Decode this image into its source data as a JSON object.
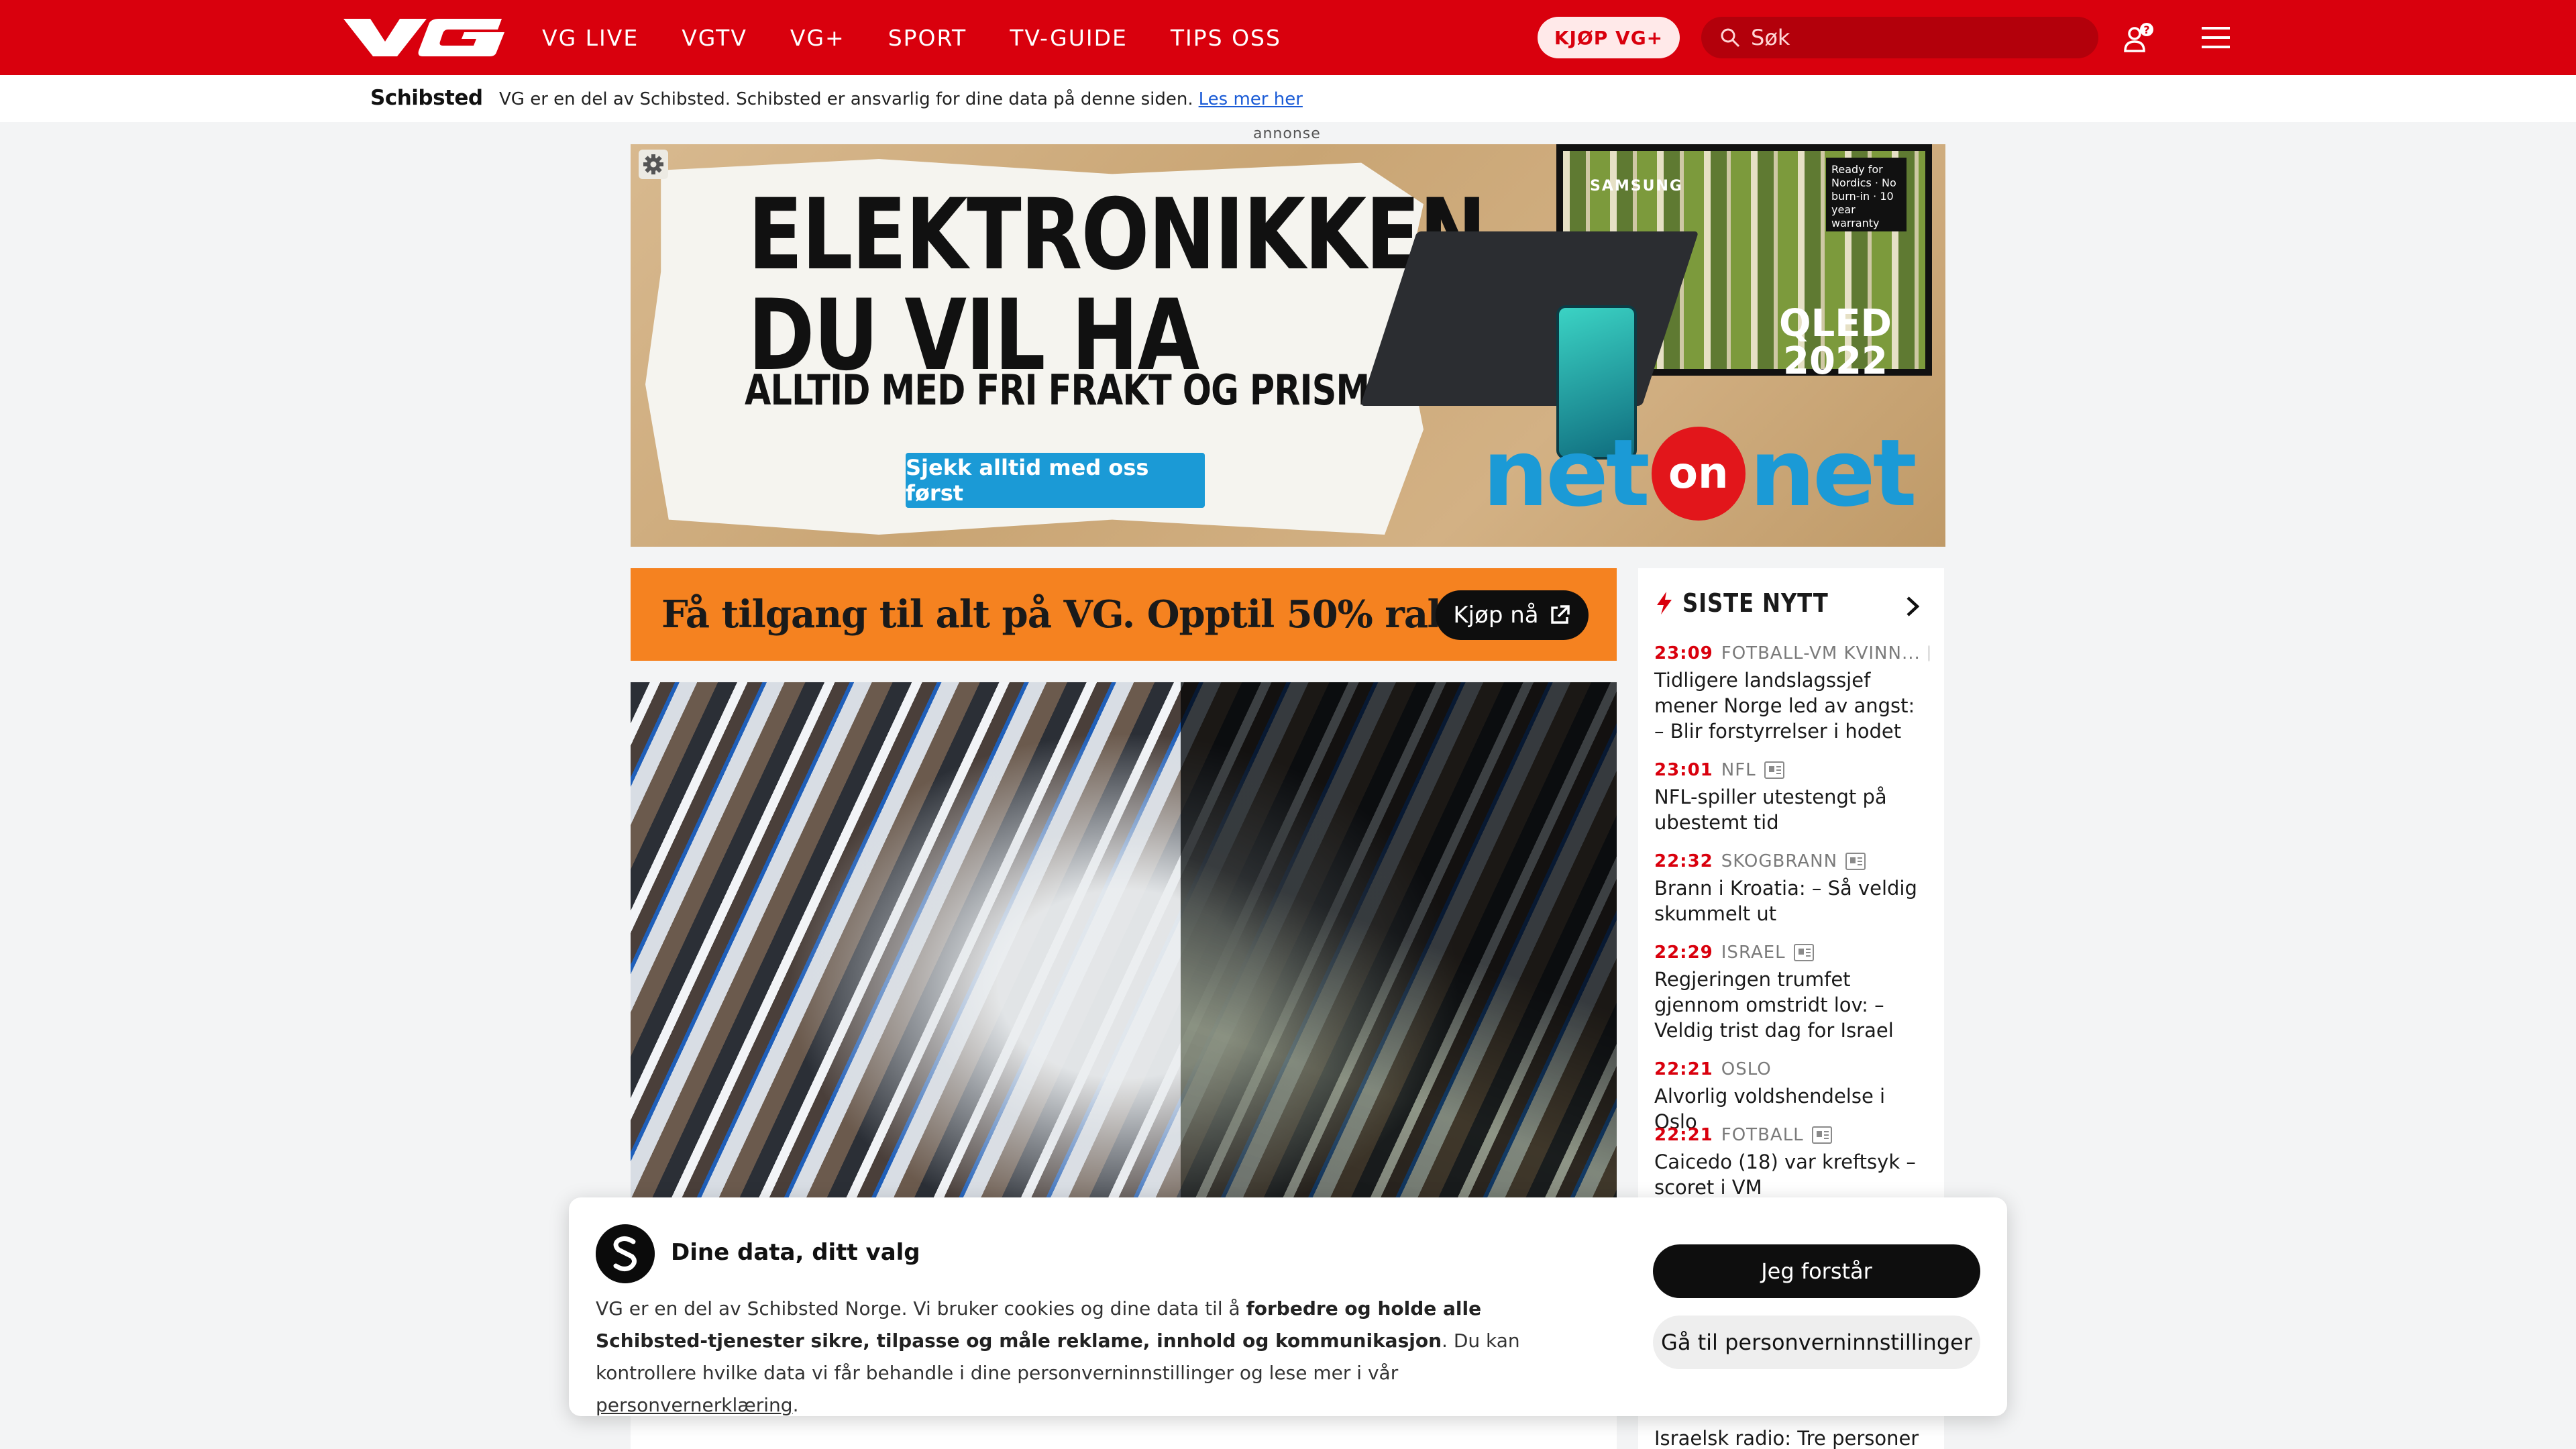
{
  "brand": {
    "accent": "#d9000d",
    "promo_orange": "#f58220",
    "link_blue": "#1a5bd6"
  },
  "header": {
    "logo_alt": "VG",
    "nav": [
      "VG LIVE",
      "VGTV",
      "VG+",
      "SPORT",
      "TV-GUIDE",
      "TIPS OSS"
    ],
    "buy_label": "KJØP VG+",
    "search_placeholder": "Søk",
    "user_badge": "?"
  },
  "schibsted_bar": {
    "logo": "Schibsted",
    "text": "VG er en del av Schibsted. Schibsted er ansvarlig for dine data på denne siden.",
    "link": "Les mer her"
  },
  "ad": {
    "label": "annonse",
    "headline_line1": "ELEKTRONIKKEN",
    "headline_line2": "DU VIL HA",
    "subline": "ALLTID MED FRI FRAKT OG PRISMATCH",
    "cta": "Sjekk alltid med oss først",
    "tv_brand": "SAMSUNG",
    "tv_badge": "Ready for Nordics · No burn-in · 10 year warranty",
    "tv_model_line1": "QLED",
    "tv_model_line2": "2022",
    "advertiser_left": "net",
    "advertiser_mid": "on",
    "advertiser_right": "net"
  },
  "promo": {
    "text": "Få tilgang til alt på VG. Opptil 50% rabatt",
    "button": "Kjøp nå"
  },
  "sidebar": {
    "title": "SISTE NYTT",
    "items": [
      {
        "time": "23:09",
        "category": "FOTBALL-VM KVINN...",
        "title": "Tidligere landslagssjef mener Norge led av angst: – Blir forstyrrelser i hodet",
        "article_icon": true
      },
      {
        "time": "23:01",
        "category": "NFL",
        "title": "NFL-spiller utestengt på ubestemt tid",
        "article_icon": true
      },
      {
        "time": "22:32",
        "category": "SKOGBRANN",
        "title": "Brann i Kroatia: – Så veldig skummelt ut",
        "article_icon": true
      },
      {
        "time": "22:29",
        "category": "ISRAEL",
        "title": "Regjeringen trumfet gjennom omstridt lov: – Veldig trist dag for Israel",
        "article_icon": true
      },
      {
        "time": "22:21",
        "category": "OSLO",
        "title": "Alvorlig voldshendelse i Oslo",
        "article_icon": false
      },
      {
        "time": "22:21",
        "category": "FOTBALL",
        "title": "Caicedo (18) var kreftsyk – scoret i VM",
        "article_icon": true
      },
      {
        "time": "",
        "category": "",
        "title": "Israelsk radio: Tre personer",
        "article_icon": false
      }
    ]
  },
  "consent": {
    "title": "Dine data, ditt valg",
    "body_1": "VG er en del av Schibsted Norge. Vi bruker cookies og dine data til å ",
    "body_bold": "forbedre og holde alle Schibsted-tjenester sikre, tilpasse og måle reklame, innhold og kommunikasjon",
    "body_2": ". Du kan kontrollere hvilke data vi får behandle i dine personverninnstillinger og lese mer i vår ",
    "body_link": "personvernerklæring",
    "body_end": ".",
    "accept": "Jeg forstår",
    "settings": "Gå til personverninnstillinger"
  }
}
